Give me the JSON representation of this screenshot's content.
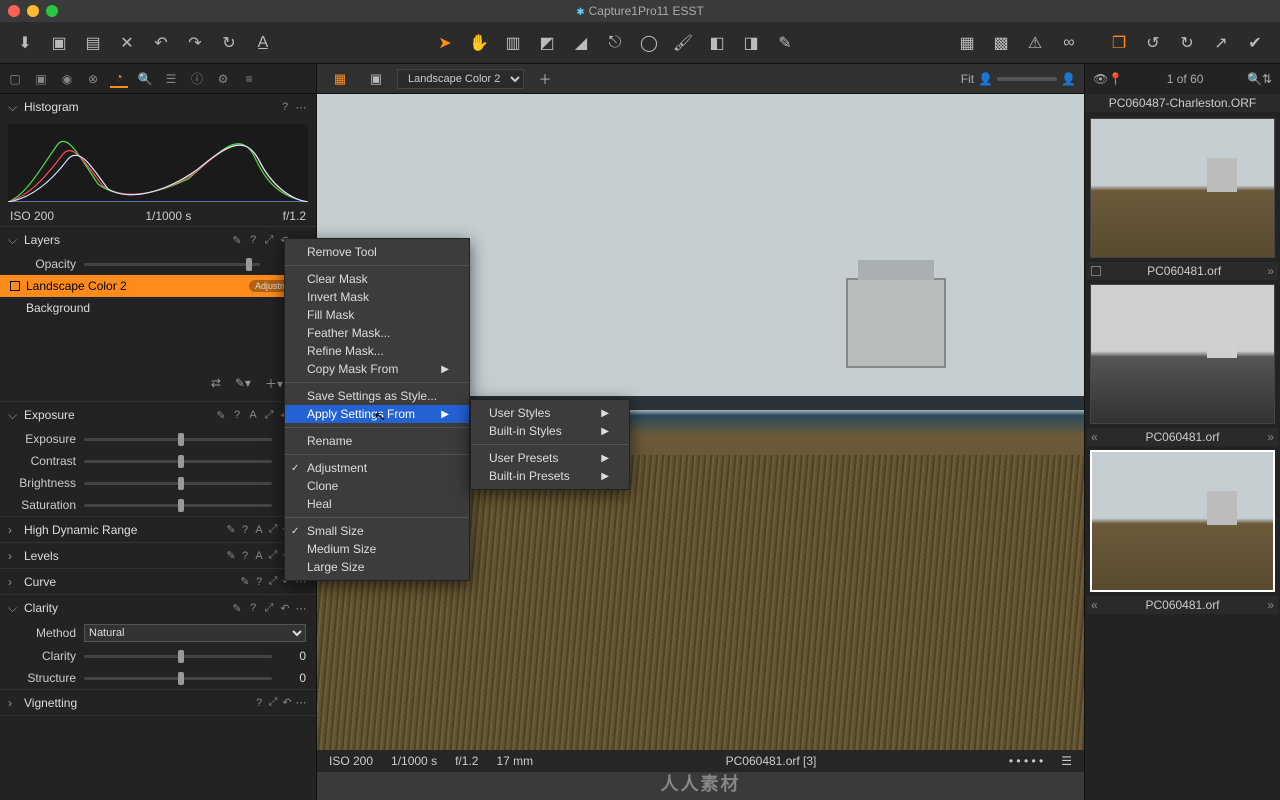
{
  "window": {
    "title": "Capture1Pro11 ESST"
  },
  "style_dropdown": "Landscape Color 2",
  "fit_label": "Fit",
  "histogram": {
    "title": "Histogram",
    "iso": "ISO 200",
    "shutter": "1/1000 s",
    "aperture": "f/1.2"
  },
  "layers": {
    "title": "Layers",
    "opacity_label": "Opacity",
    "items": [
      {
        "name": "Landscape Color 2",
        "badge": "Adjustment",
        "selected": true
      },
      {
        "name": "Background",
        "badge": null,
        "selected": false
      }
    ]
  },
  "exposure": {
    "title": "Exposure",
    "rows": [
      {
        "label": "Exposure",
        "value": ""
      },
      {
        "label": "Contrast",
        "value": ""
      },
      {
        "label": "Brightness",
        "value": ""
      },
      {
        "label": "Saturation",
        "value": ""
      }
    ]
  },
  "hdr": {
    "title": "High Dynamic Range"
  },
  "levels": {
    "title": "Levels"
  },
  "curve": {
    "title": "Curve"
  },
  "clarity": {
    "title": "Clarity",
    "method_label": "Method",
    "method_value": "Natural",
    "rows": [
      {
        "label": "Clarity",
        "value": "0"
      },
      {
        "label": "Structure",
        "value": "0"
      }
    ]
  },
  "vignetting": {
    "title": "Vignetting"
  },
  "context_menu": {
    "items": [
      {
        "label": "Remove Tool",
        "type": "item"
      },
      {
        "type": "sep"
      },
      {
        "label": "Clear Mask",
        "type": "item"
      },
      {
        "label": "Invert Mask",
        "type": "item"
      },
      {
        "label": "Fill Mask",
        "type": "item"
      },
      {
        "label": "Feather Mask...",
        "type": "item"
      },
      {
        "label": "Refine Mask...",
        "type": "item"
      },
      {
        "label": "Copy Mask From",
        "type": "sub"
      },
      {
        "type": "sep"
      },
      {
        "label": "Save Settings as Style...",
        "type": "item"
      },
      {
        "label": "Apply Settings From",
        "type": "sub",
        "highlight": true
      },
      {
        "type": "sep"
      },
      {
        "label": "Rename",
        "type": "item"
      },
      {
        "type": "sep"
      },
      {
        "label": "Adjustment",
        "type": "check",
        "checked": true
      },
      {
        "label": "Clone",
        "type": "item"
      },
      {
        "label": "Heal",
        "type": "item"
      },
      {
        "type": "sep"
      },
      {
        "label": "Small Size",
        "type": "check",
        "checked": true
      },
      {
        "label": "Medium Size",
        "type": "item"
      },
      {
        "label": "Large Size",
        "type": "item"
      }
    ]
  },
  "submenu": {
    "items": [
      {
        "label": "User Styles"
      },
      {
        "label": "Built-in Styles"
      },
      {
        "type": "sep"
      },
      {
        "label": "User Presets"
      },
      {
        "label": "Built-in Presets"
      }
    ]
  },
  "meta_bar": {
    "iso": "ISO 200",
    "shutter": "1/1000 s",
    "aperture": "f/1.2",
    "focal": "17 mm",
    "filename": "PC060481.orf [3]"
  },
  "browser": {
    "counter": "1 of 60",
    "top_filename": "PC060487-Charleston.ORF",
    "thumbs": [
      {
        "num": "1",
        "name": "PC060481.orf",
        "bw": false
      },
      {
        "num": "2",
        "name": "PC060481.orf",
        "bw": true
      },
      {
        "num": "3",
        "name": "PC060481.orf",
        "bw": false,
        "selected": true
      }
    ]
  },
  "watermark": "人人素材"
}
